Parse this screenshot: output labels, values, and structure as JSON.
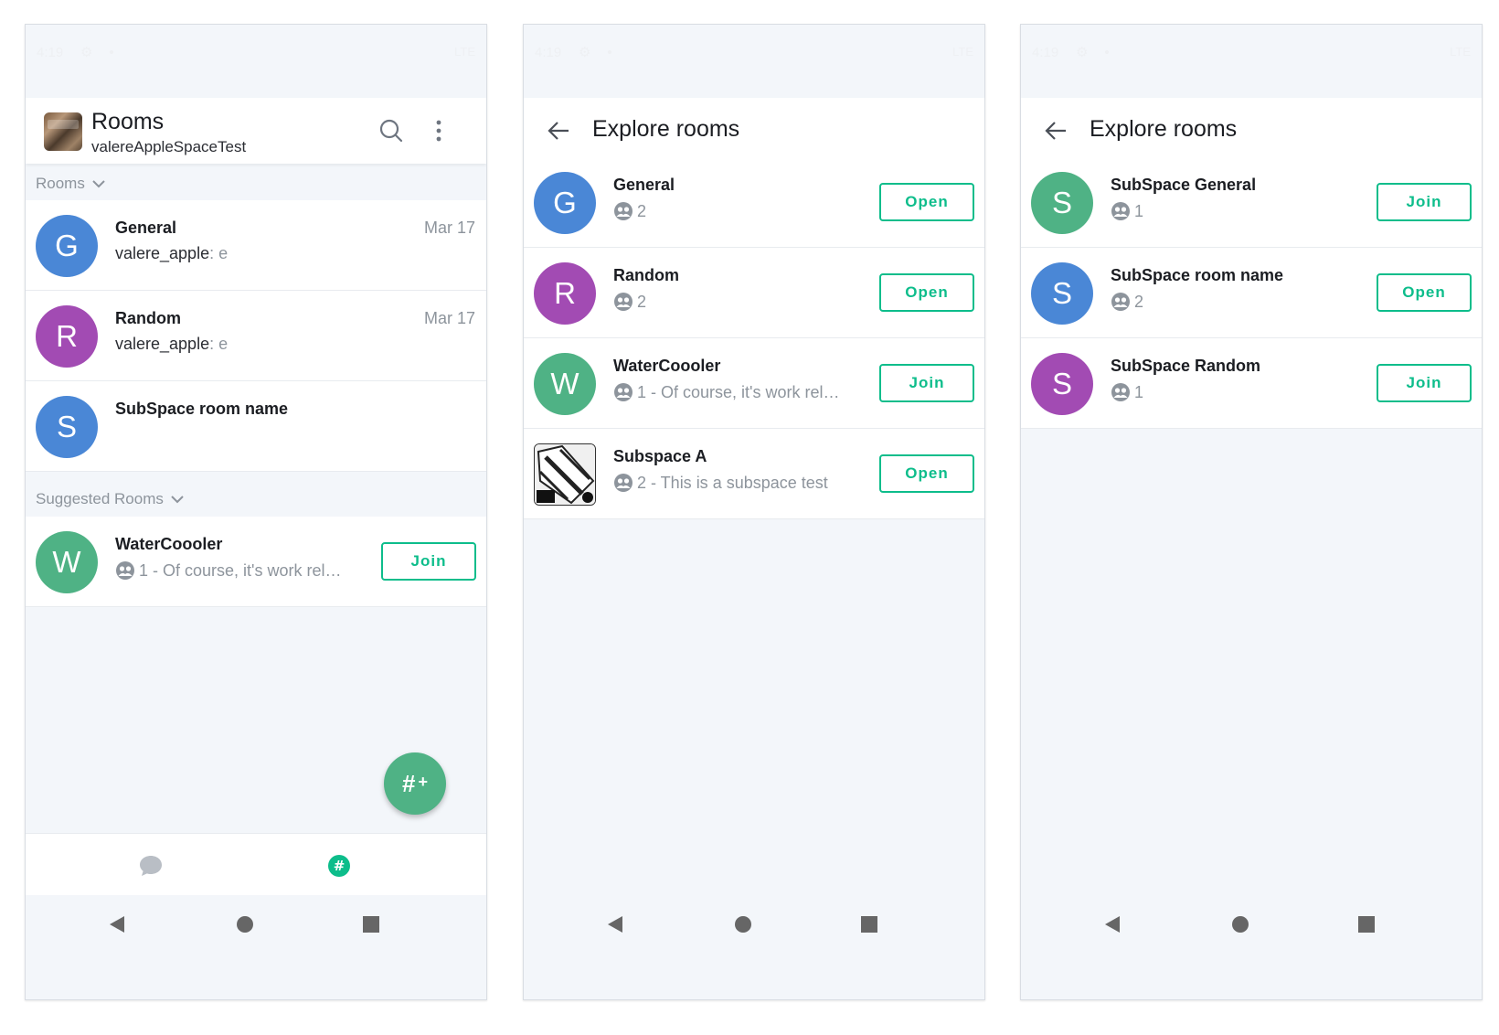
{
  "status_bar": {
    "time": "4:19",
    "network": "LTE"
  },
  "screen1": {
    "title": "Rooms",
    "subtitle": "valereAppleSpaceTest",
    "sections": {
      "rooms": "Rooms",
      "suggested": "Suggested Rooms"
    },
    "rooms": [
      {
        "avatar": "G",
        "color": "#4a87d6",
        "name": "General",
        "date": "Mar 17",
        "sender": "valere_apple",
        "message": ": e"
      },
      {
        "avatar": "R",
        "color": "#a24bb3",
        "name": "Random",
        "date": "Mar 17",
        "sender": "valere_apple",
        "message": ": e"
      },
      {
        "avatar": "S",
        "color": "#4a87d6",
        "name": "SubSpace room name"
      }
    ],
    "suggested": [
      {
        "avatar": "W",
        "color": "#4fb285",
        "name": "WaterCoooler",
        "meta": "1 - Of course, it's work relat…",
        "action": "Join"
      }
    ],
    "fab_label": "#",
    "fab_plus": "+",
    "nav": [
      "chat-icon",
      "hash-icon"
    ]
  },
  "screen2": {
    "title": "Explore rooms",
    "rooms": [
      {
        "avatar": "G",
        "color": "#4a87d6",
        "name": "General",
        "meta": "2",
        "action": "Open"
      },
      {
        "avatar": "R",
        "color": "#a24bb3",
        "name": "Random",
        "meta": "2",
        "action": "Open"
      },
      {
        "avatar": "W",
        "color": "#4fb285",
        "name": "WaterCoooler",
        "meta": "1 - Of course, it's work relat…",
        "action": "Join"
      },
      {
        "avatar": "image",
        "name": "Subspace A",
        "meta": "2 - This is a subspace test",
        "action": "Open"
      }
    ]
  },
  "screen3": {
    "title": "Explore rooms",
    "rooms": [
      {
        "avatar": "S",
        "color": "#4fb285",
        "name": "SubSpace General",
        "meta": "1",
        "action": "Join"
      },
      {
        "avatar": "S",
        "color": "#4a87d6",
        "name": "SubSpace room name",
        "meta": "2",
        "action": "Open"
      },
      {
        "avatar": "S",
        "color": "#a24bb3",
        "name": "SubSpace Random",
        "meta": "1",
        "action": "Join"
      }
    ]
  },
  "colors": {
    "accent": "#0dbd8b",
    "fab": "#4fb285",
    "muted": "#8d949c"
  }
}
